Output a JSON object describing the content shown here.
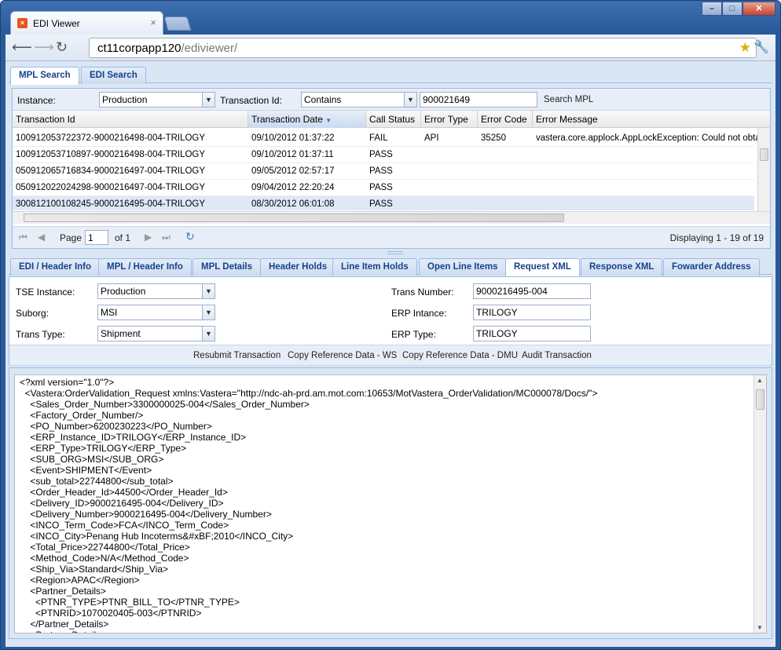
{
  "browser": {
    "tab_title": "EDI Viewer",
    "tab_close": "×",
    "url_host": "ct11corpapp120",
    "url_path": "/ediviewer/",
    "favicon": "×"
  },
  "top_tabs": [
    {
      "label": "MPL Search",
      "active": true
    },
    {
      "label": "EDI Search",
      "active": false
    }
  ],
  "search": {
    "instance_label": "Instance:",
    "instance_value": "Production",
    "txn_label": "Transaction Id:",
    "match_value": "Contains",
    "txn_value": "900021649",
    "search_button": "Search MPL"
  },
  "grid": {
    "columns": [
      "Transaction Id",
      "Transaction Date",
      "Call Status",
      "Error Type",
      "Error Code",
      "Error Message"
    ],
    "sort_icon": "▼",
    "rows": [
      [
        "100912053722372-9000216498-004-TRILOGY",
        "09/10/2012 01:37:22",
        "FAIL",
        "API",
        "35250",
        "vastera.core.applock.AppLockException: Could not obtain"
      ],
      [
        "100912053710897-9000216498-004-TRILOGY",
        "09/10/2012 01:37:11",
        "PASS",
        "",
        "",
        ""
      ],
      [
        "050912065716834-9000216497-004-TRILOGY",
        "09/05/2012 02:57:17",
        "PASS",
        "",
        "",
        ""
      ],
      [
        "050912022024298-9000216497-004-TRILOGY",
        "09/04/2012 22:20:24",
        "PASS",
        "",
        "",
        ""
      ],
      [
        "300812100108245-9000216495-004-TRILOGY",
        "08/30/2012 06:01:08",
        "PASS",
        "",
        "",
        ""
      ]
    ],
    "selected_row": 4
  },
  "pager": {
    "page_label": "Page",
    "page_value": "1",
    "of_label": "of 1",
    "displaying": "Displaying 1 - 19 of 19"
  },
  "detail_tabs": [
    {
      "label": "EDI / Header Info",
      "active": false
    },
    {
      "label": "MPL / Header Info",
      "active": false
    },
    {
      "label": "MPL Details",
      "active": false
    },
    {
      "label": "Header Holds",
      "active": false
    },
    {
      "label": "Line Item Holds",
      "active": false
    },
    {
      "label": "Open Line Items",
      "active": false
    },
    {
      "label": "Request XML",
      "active": true
    },
    {
      "label": "Response XML",
      "active": false
    },
    {
      "label": "Fowarder Address",
      "active": false
    }
  ],
  "detail_form": {
    "tse_label": "TSE Instance:",
    "tse_value": "Production",
    "suborg_label": "Suborg:",
    "suborg_value": "MSI",
    "trans_type_label": "Trans Type:",
    "trans_type_value": "Shipment",
    "trans_number_label": "Trans Number:",
    "trans_number_value": "9000216495-004",
    "erp_instance_label": "ERP Intance:",
    "erp_instance_value": "TRILOGY",
    "erp_type_label": "ERP Type:",
    "erp_type_value": "TRILOGY"
  },
  "actions": [
    "Resubmit Transaction",
    "Copy Reference Data - WS",
    "Copy Reference Data - DMU",
    "Audit Transaction"
  ],
  "xml_lines": [
    "<?xml version=\"1.0\"?>",
    "  <Vastera:OrderValidation_Request xmlns:Vastera=\"http://ndc-ah-prd.am.mot.com:10653/MotVastera_OrderValidation/MC000078/Docs/\">",
    "    <Sales_Order_Number>3300000025-004</Sales_Order_Number>",
    "    <Factory_Order_Number/>",
    "    <PO_Number>6200230223</PO_Number>",
    "    <ERP_Instance_ID>TRILOGY</ERP_Instance_ID>",
    "    <ERP_Type>TRILOGY</ERP_Type>",
    "    <SUB_ORG>MSI</SUB_ORG>",
    "    <Event>SHIPMENT</Event>",
    "    <sub_total>22744800</sub_total>",
    "    <Order_Header_Id>44500</Order_Header_Id>",
    "    <Delivery_ID>9000216495-004</Delivery_ID>",
    "    <Delivery_Number>9000216495-004</Delivery_Number>",
    "    <INCO_Term_Code>FCA</INCO_Term_Code>",
    "    <INCO_City>Penang Hub Incoterms&#xBF;2010</INCO_City>",
    "    <Total_Price>22744800</Total_Price>",
    "    <Method_Code>N/A</Method_Code>",
    "    <Ship_Via>Standard</Ship_Via>",
    "    <Region>APAC</Region>",
    "    <Partner_Details>",
    "      <PTNR_TYPE>PTNR_BILL_TO</PTNR_TYPE>",
    "      <PTNRID>1070020405-003</PTNRID>",
    "    </Partner_Details>",
    "    <Partner_Details>"
  ],
  "colors": {
    "accent": "#15428b",
    "frame": "#2a5a9a",
    "panel_border": "#99bbe8"
  }
}
